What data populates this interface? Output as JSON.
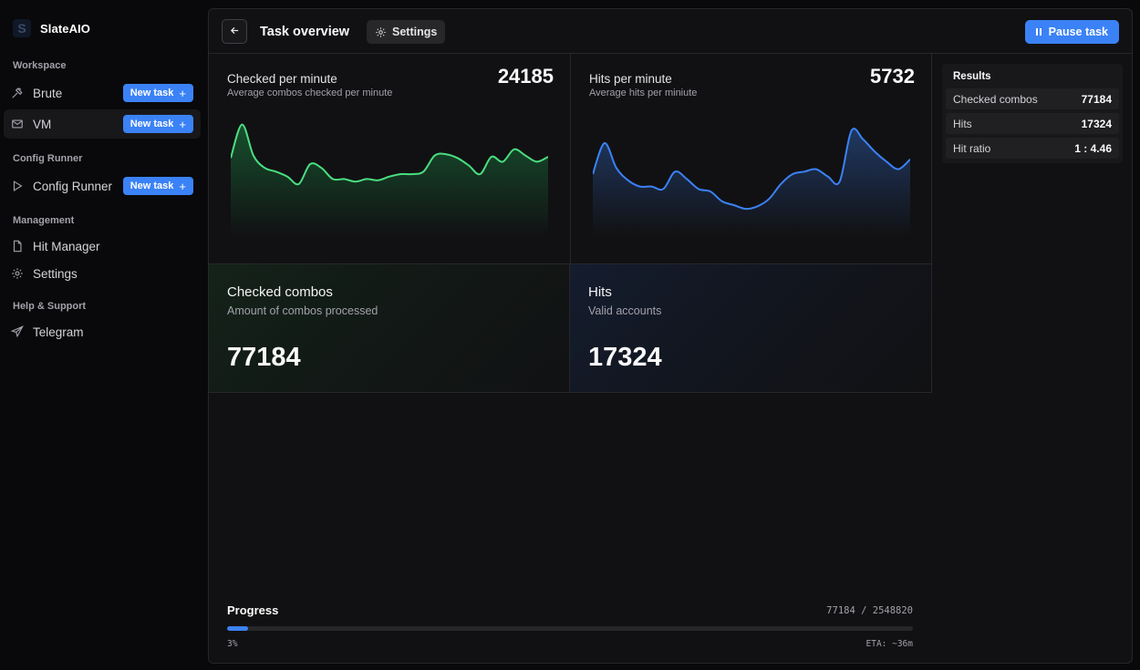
{
  "brand": {
    "logo_letter": "S",
    "name": "SlateAIO"
  },
  "sidebar": {
    "sections": [
      {
        "title": "Workspace"
      },
      {
        "title": "Config Runner"
      },
      {
        "title": "Management"
      },
      {
        "title": "Help & Support"
      }
    ],
    "items": [
      {
        "label": "Brute",
        "icon": "hammer-icon",
        "new_task": "New task"
      },
      {
        "label": "VM",
        "icon": "mail-icon",
        "new_task": "New task",
        "active": true
      },
      {
        "label": "Config Runner",
        "icon": "play-icon",
        "new_task": "New task"
      },
      {
        "label": "Hit Manager",
        "icon": "file-icon"
      },
      {
        "label": "Settings",
        "icon": "gear-icon"
      },
      {
        "label": "Telegram",
        "icon": "send-icon"
      }
    ],
    "new_task_plus": "+"
  },
  "topbar": {
    "back_icon": "arrow-left-icon",
    "title": "Task overview",
    "settings_label": "Settings",
    "pause_label": "Pause task"
  },
  "charts": {
    "checked": {
      "title": "Checked per minute",
      "subtitle": "Average combos checked per minute",
      "value": "24185",
      "color": "#4ade80"
    },
    "hits": {
      "title": "Hits per minute",
      "subtitle": "Average hits per miniute",
      "value": "5732",
      "color": "#3b82f6"
    }
  },
  "chart_data": [
    {
      "type": "area",
      "series": [
        {
          "values": [
            63,
            90,
            65,
            55,
            52,
            48,
            42,
            58,
            55,
            46,
            46,
            44,
            46,
            45,
            48,
            50,
            50,
            52,
            65,
            66,
            63,
            57,
            50,
            64,
            60,
            70,
            65,
            60,
            64
          ]
        }
      ]
    },
    {
      "type": "area",
      "series": [
        {
          "values": [
            50,
            75,
            55,
            45,
            40,
            40,
            38,
            52,
            46,
            38,
            36,
            28,
            25,
            22,
            24,
            30,
            42,
            50,
            52,
            54,
            48,
            44,
            85,
            78,
            68,
            60,
            54,
            62
          ]
        }
      ]
    }
  ],
  "stats": {
    "checked": {
      "title": "Checked combos",
      "subtitle": "Amount of combos processed",
      "value": "77184"
    },
    "hits": {
      "title": "Hits",
      "subtitle": "Valid accounts",
      "value": "17324"
    }
  },
  "results": {
    "title": "Results",
    "rows": [
      {
        "label": "Checked combos",
        "value": "77184"
      },
      {
        "label": "Hits",
        "value": "17324"
      },
      {
        "label": "Hit ratio",
        "value": "1 : 4.46"
      }
    ]
  },
  "progress": {
    "label": "Progress",
    "count": "77184 / 2548820",
    "percent_text": "3%",
    "fraction": 0.03,
    "eta": "ETA: ~36m"
  }
}
